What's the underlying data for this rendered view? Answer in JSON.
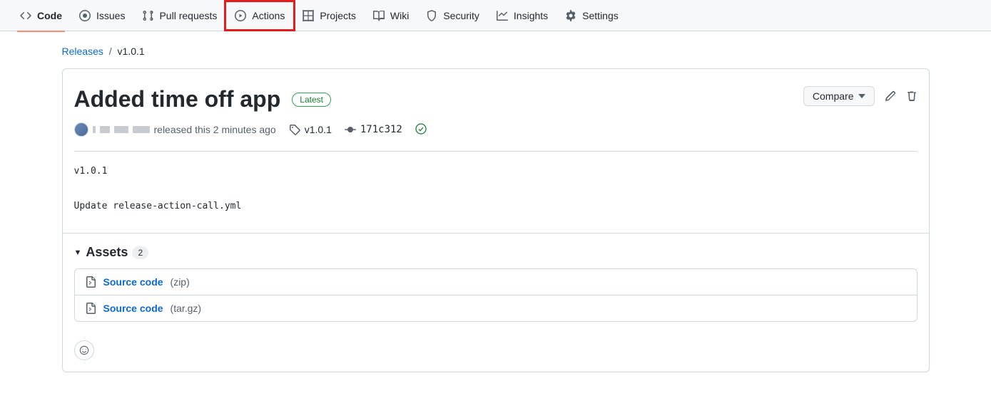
{
  "nav": {
    "code": "Code",
    "issues": "Issues",
    "pulls": "Pull requests",
    "actions": "Actions",
    "projects": "Projects",
    "wiki": "Wiki",
    "security": "Security",
    "insights": "Insights",
    "settings": "Settings"
  },
  "breadcrumb": {
    "releases": "Releases",
    "current": "v1.0.1"
  },
  "release": {
    "title": "Added time off app",
    "latest_label": "Latest",
    "compare_label": "Compare",
    "released_text": "released this 2 minutes ago",
    "tag": "v1.0.1",
    "commit": "171c312",
    "body_line1": "v1.0.1",
    "body_line2": "Update release-action-call.yml"
  },
  "assets": {
    "heading": "Assets",
    "count": "2",
    "items": [
      {
        "name": "Source code",
        "ext": "(zip)"
      },
      {
        "name": "Source code",
        "ext": "(tar.gz)"
      }
    ]
  }
}
